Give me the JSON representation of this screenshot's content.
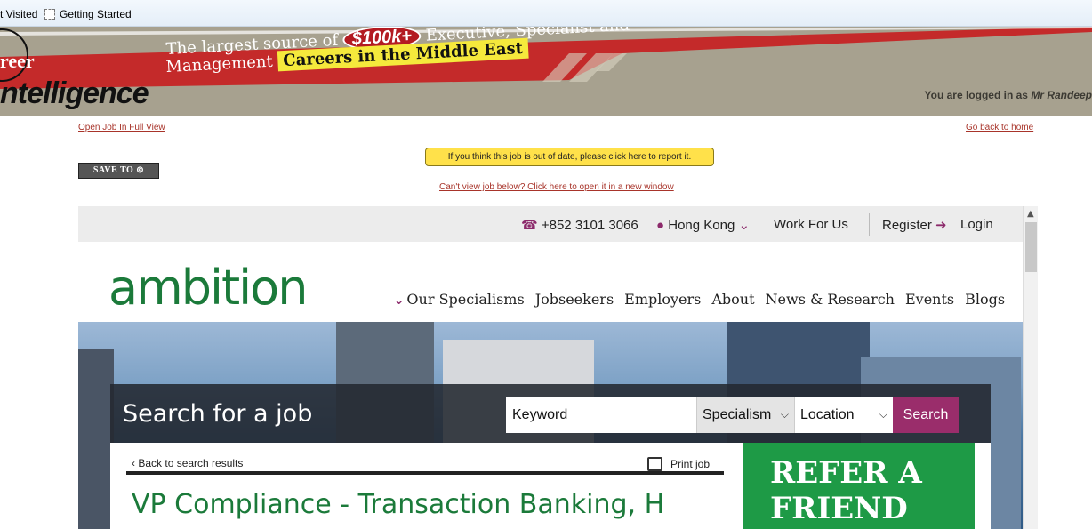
{
  "bookmarks": [
    {
      "label": "t Visited"
    },
    {
      "label": "Getting Started"
    }
  ],
  "banner": {
    "logo_top": "reer",
    "logo_bottom": "ntelligence",
    "line1_prefix": "The largest source of",
    "highlight_amount": "$100k+",
    "line1_suffix": "Executive, Specialist and",
    "line2_prefix": "Management",
    "line2_highlight": "Careers in the Middle East",
    "logged_in_prefix": "You are logged in as",
    "logged_in_user": "Mr Randeep"
  },
  "page_links": {
    "open_full_view": "Open Job In Full View",
    "go_back_home": "Go back to home",
    "save_to": "SAVE TO",
    "report": "If you think this job is out of date, please click here to report it.",
    "cant_view": "Can't view job below? Click here to open it in a new window"
  },
  "site": {
    "topbar": {
      "phone": "+852 3101 3066",
      "region": "Hong Kong",
      "work_for_us": "Work For Us",
      "register": "Register",
      "login": "Login"
    },
    "logo": "ambition",
    "nav": [
      "Our Specialisms",
      "Jobseekers",
      "Employers",
      "About",
      "News & Research",
      "Events",
      "Blogs"
    ],
    "search": {
      "title": "Search for a job",
      "keyword_placeholder": "Keyword",
      "specialism": "Specialism",
      "location": "Location",
      "button": "Search"
    },
    "job": {
      "back": "Back to search results",
      "print": "Print job",
      "title_partial": "VP Compliance - Transaction Banking, H"
    },
    "refer": {
      "line1": "REFER A",
      "line2": "FRIEND"
    }
  },
  "colors": {
    "brand_green": "#1b7a3a",
    "accent_purple": "#9a2d6b",
    "banner_red": "#b31b22",
    "banner_yellow": "#f5e93c",
    "refer_green": "#1e9a46"
  }
}
